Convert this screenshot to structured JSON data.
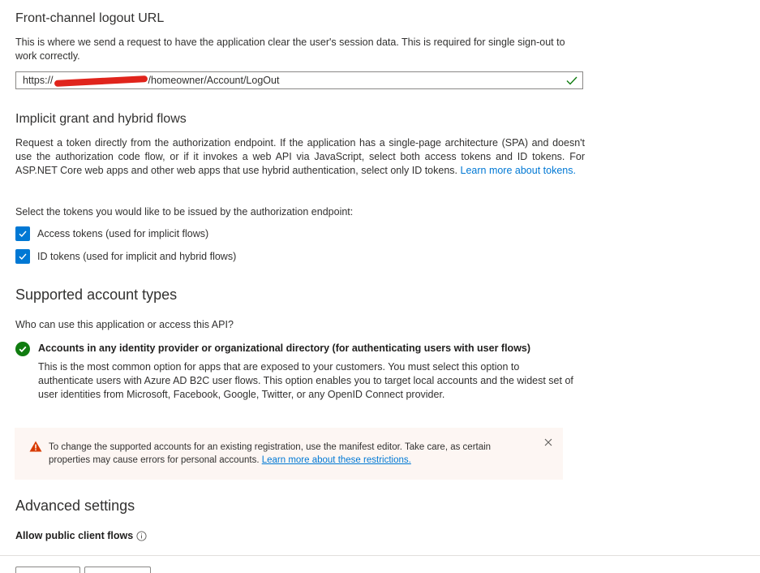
{
  "logout": {
    "title": "Front-channel logout URL",
    "description": "This is where we send a request to have the application clear the user's session data. This is required for single sign-out to work correctly.",
    "url_prefix": "https://",
    "url_suffix": "/homeowner/Account/LogOut"
  },
  "implicit": {
    "title": "Implicit grant and hybrid flows",
    "description": "Request a token directly from the authorization endpoint. If the application has a single-page architecture (SPA) and doesn't use the authorization code flow, or if it invokes a web API via JavaScript, select both access tokens and ID tokens. For ASP.NET Core web apps and other web apps that use hybrid authentication, select only ID tokens.",
    "learn_more": "Learn more about tokens.",
    "select_label": "Select the tokens you would like to be issued by the authorization endpoint:",
    "access_tokens_label": "Access tokens (used for implicit flows)",
    "id_tokens_label": "ID tokens (used for implicit and hybrid flows)"
  },
  "accounts": {
    "title": "Supported account types",
    "question": "Who can use this application or access this API?",
    "option_title": "Accounts in any identity provider or organizational directory (for authenticating users with user flows)",
    "option_description": "This is the most common option for apps that are exposed to your customers. You must select this option to authenticate users with Azure AD B2C user flows. This option enables you to target local accounts and the widest set of user identities from Microsoft, Facebook, Google, Twitter, or any OpenID Connect provider."
  },
  "warning": {
    "text": "To change the supported accounts for an existing registration, use the manifest editor. Take care, as certain properties may cause errors for personal accounts.",
    "link": "Learn more about these restrictions."
  },
  "advanced": {
    "title": "Advanced settings",
    "public_flows_label": "Allow public client flows"
  },
  "colors": {
    "accent": "#0078d4",
    "success": "#107c10",
    "warning": "#d83b01",
    "warning_bg": "#fdf6f3"
  }
}
